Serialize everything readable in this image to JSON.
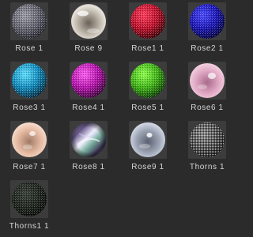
{
  "materials": [
    {
      "label": "Rose 1",
      "icon": "sphere-grey-noise-icon"
    },
    {
      "label": "Rose 9",
      "icon": "sphere-glass-icon"
    },
    {
      "label": "Rose1 1",
      "icon": "sphere-red-noise-icon"
    },
    {
      "label": "Rose2 1",
      "icon": "sphere-blue-noise-icon"
    },
    {
      "label": "Rose3 1",
      "icon": "sphere-cyan-noise-icon"
    },
    {
      "label": "Rose4 1",
      "icon": "sphere-magenta-noise-icon"
    },
    {
      "label": "Rose5 1",
      "icon": "sphere-green-noise-icon"
    },
    {
      "label": "Rose6 1",
      "icon": "sphere-pink-glass-icon"
    },
    {
      "label": "Rose7 1",
      "icon": "sphere-peach-glass-icon"
    },
    {
      "label": "Rose8 1",
      "icon": "sphere-iridescent-icon"
    },
    {
      "label": "Rose9 1",
      "icon": "sphere-clear-glass-icon"
    },
    {
      "label": "Thorns 1",
      "icon": "sphere-thorns-noise-icon"
    },
    {
      "label": "Thorns1 1",
      "icon": "sphere-dark-thorns-icon"
    }
  ],
  "colors": {
    "background": "#2b2b2b",
    "thumb_background": "#3c3c3c",
    "label_text": "#d6d6d6"
  }
}
